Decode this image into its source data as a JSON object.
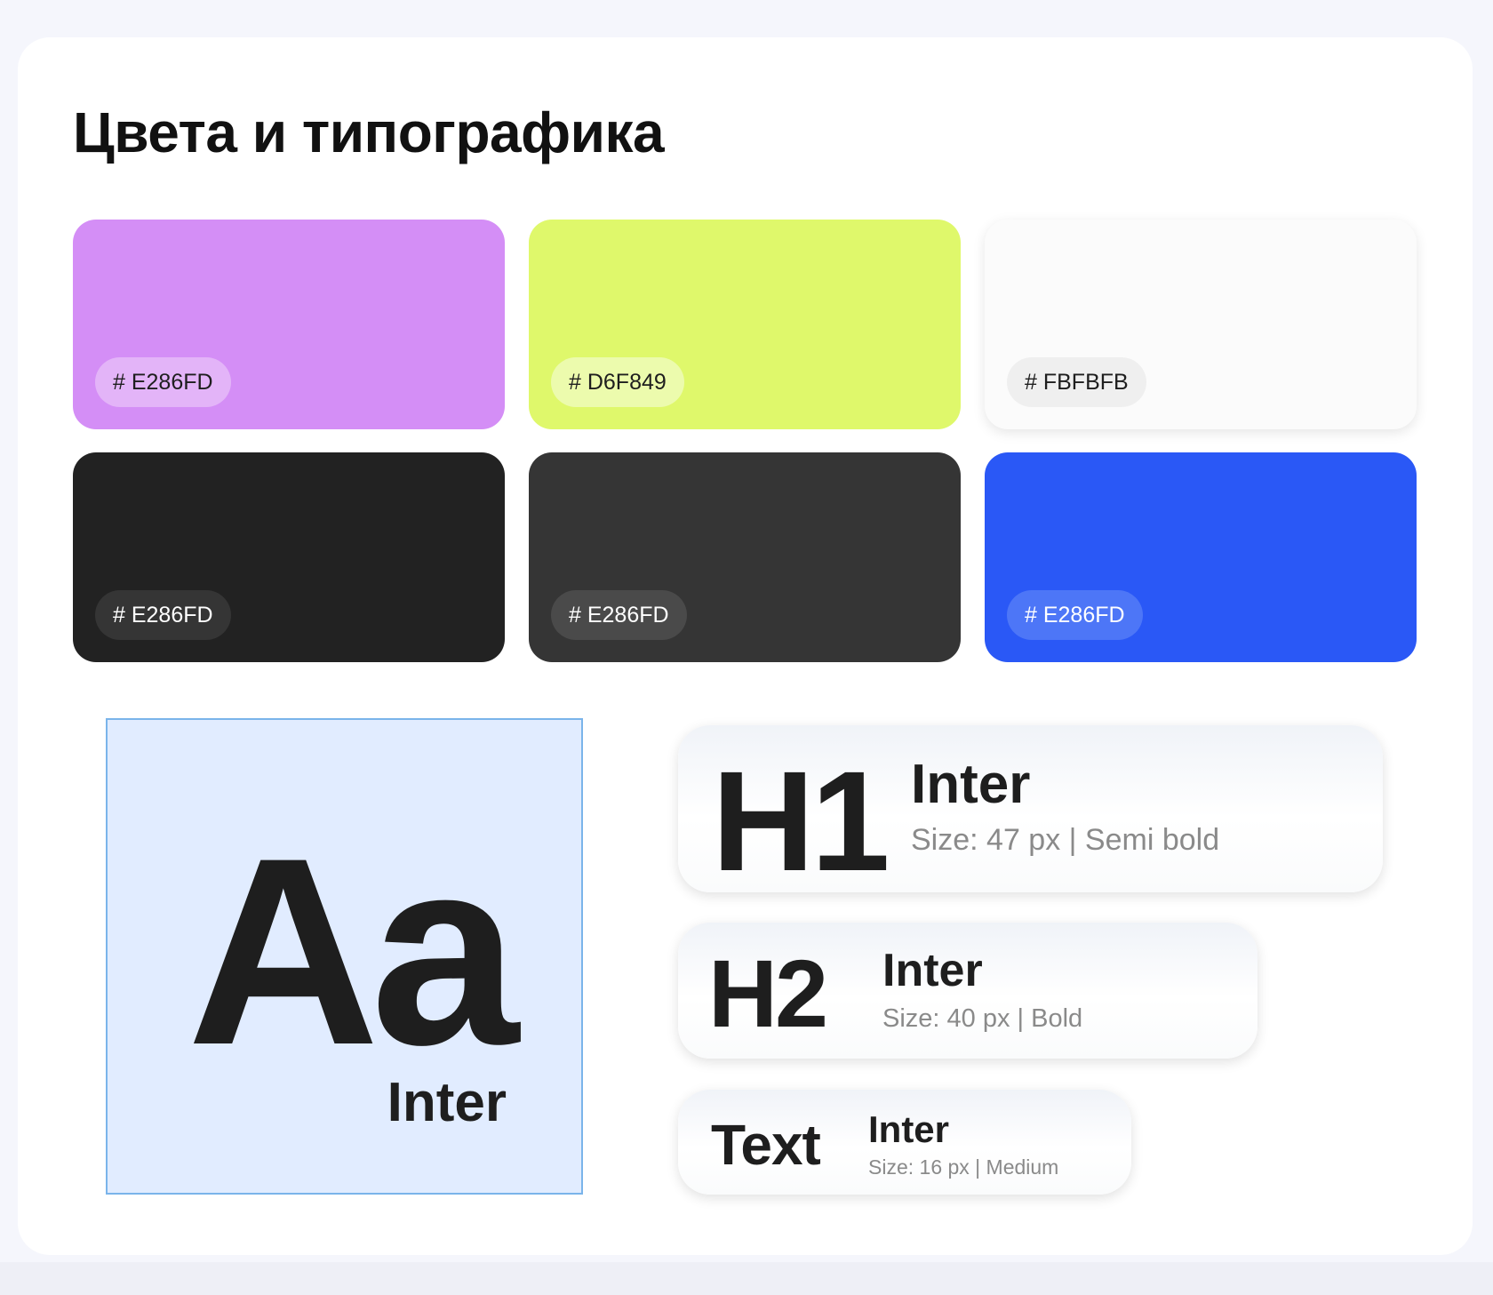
{
  "title": "Цвета и типографика",
  "swatches": [
    {
      "color": "#d48ef6",
      "label": "# E286FD",
      "badge_bg": "#e3b4f8",
      "label_color": "#1e1e1e",
      "light": false
    },
    {
      "color": "#dff86b",
      "label": "# D6F849",
      "badge_bg": "#ecfbad",
      "label_color": "#1e1e1e",
      "light": false
    },
    {
      "color": "#fbfbfb",
      "label": "# FBFBFB",
      "badge_bg": "#efefef",
      "label_color": "#1e1e1e",
      "light": true
    },
    {
      "color": "#222222",
      "label": "# E286FD",
      "badge_bg": "#353535",
      "label_color": "#ffffff",
      "light": false
    },
    {
      "color": "#353535",
      "label": "# E286FD",
      "badge_bg": "#4a4a4a",
      "label_color": "#ffffff",
      "light": false
    },
    {
      "color": "#2a58f6",
      "label": "# E286FD",
      "badge_bg": "#4d76f7",
      "label_color": "#ffffff",
      "light": false
    }
  ],
  "typography": {
    "sample_glyph": "Aa",
    "font_name": "Inter",
    "styles": [
      {
        "sample": "H1",
        "font": "Inter",
        "spec": "Size: 47 px | Semi bold"
      },
      {
        "sample": "H2",
        "font": "Inter",
        "spec": "Size: 40 px | Bold"
      },
      {
        "sample": "Text",
        "font": "Inter",
        "spec": "Size: 16 px | Medium"
      }
    ]
  }
}
